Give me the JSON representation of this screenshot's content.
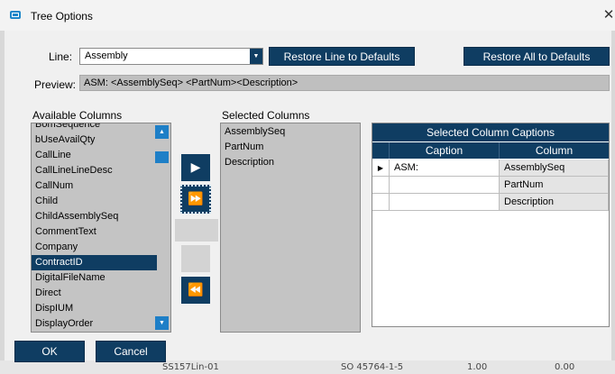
{
  "window": {
    "title": "Tree Options",
    "close_glyph": "✕"
  },
  "line": {
    "label": "Line:",
    "value": "Assembly"
  },
  "buttons": {
    "restore_line": "Restore Line to Defaults",
    "restore_all": "Restore All to Defaults",
    "ok": "OK",
    "cancel": "Cancel"
  },
  "preview": {
    "label": "Preview:",
    "value": "ASM: <AssemblySeq> <PartNum><Description>"
  },
  "available": {
    "label": "Available Columns",
    "items": [
      "BomSequence",
      "bUseAvailQty",
      "CallLine",
      "CallLineLineDesc",
      "CallNum",
      "Child",
      "ChildAssemblySeq",
      "CommentText",
      "Company",
      "ContractID",
      "DigitalFileName",
      "Direct",
      "DispIUM",
      "DisplayOrder"
    ],
    "selected_index": 9
  },
  "selected": {
    "label": "Selected Columns",
    "items": [
      "AssemblySeq",
      "PartNum",
      "Description"
    ]
  },
  "captions": {
    "title": "Selected Column Captions",
    "headers": {
      "caption": "Caption",
      "column": "Column"
    },
    "rows": [
      {
        "caption": "ASM:",
        "column": "AssemblySeq"
      },
      {
        "caption": "",
        "column": "PartNum"
      },
      {
        "caption": "",
        "column": "Description"
      }
    ]
  },
  "icons": {
    "add": "▶",
    "add_all": "⏩",
    "remove_all": "⏪",
    "row_pointer": "▶",
    "dropdown": "▼",
    "scroll_up": "▲",
    "scroll_down": "▼"
  },
  "background_strip": {
    "left_text": "SS157Lin-01",
    "right_text": "SO 45764-1-5",
    "num1": "1.00",
    "num2": "0.00"
  },
  "colors": {
    "navy": "#0f3d62",
    "scroll_blue": "#1e7fc7",
    "list_bg": "#c4c4c4"
  }
}
